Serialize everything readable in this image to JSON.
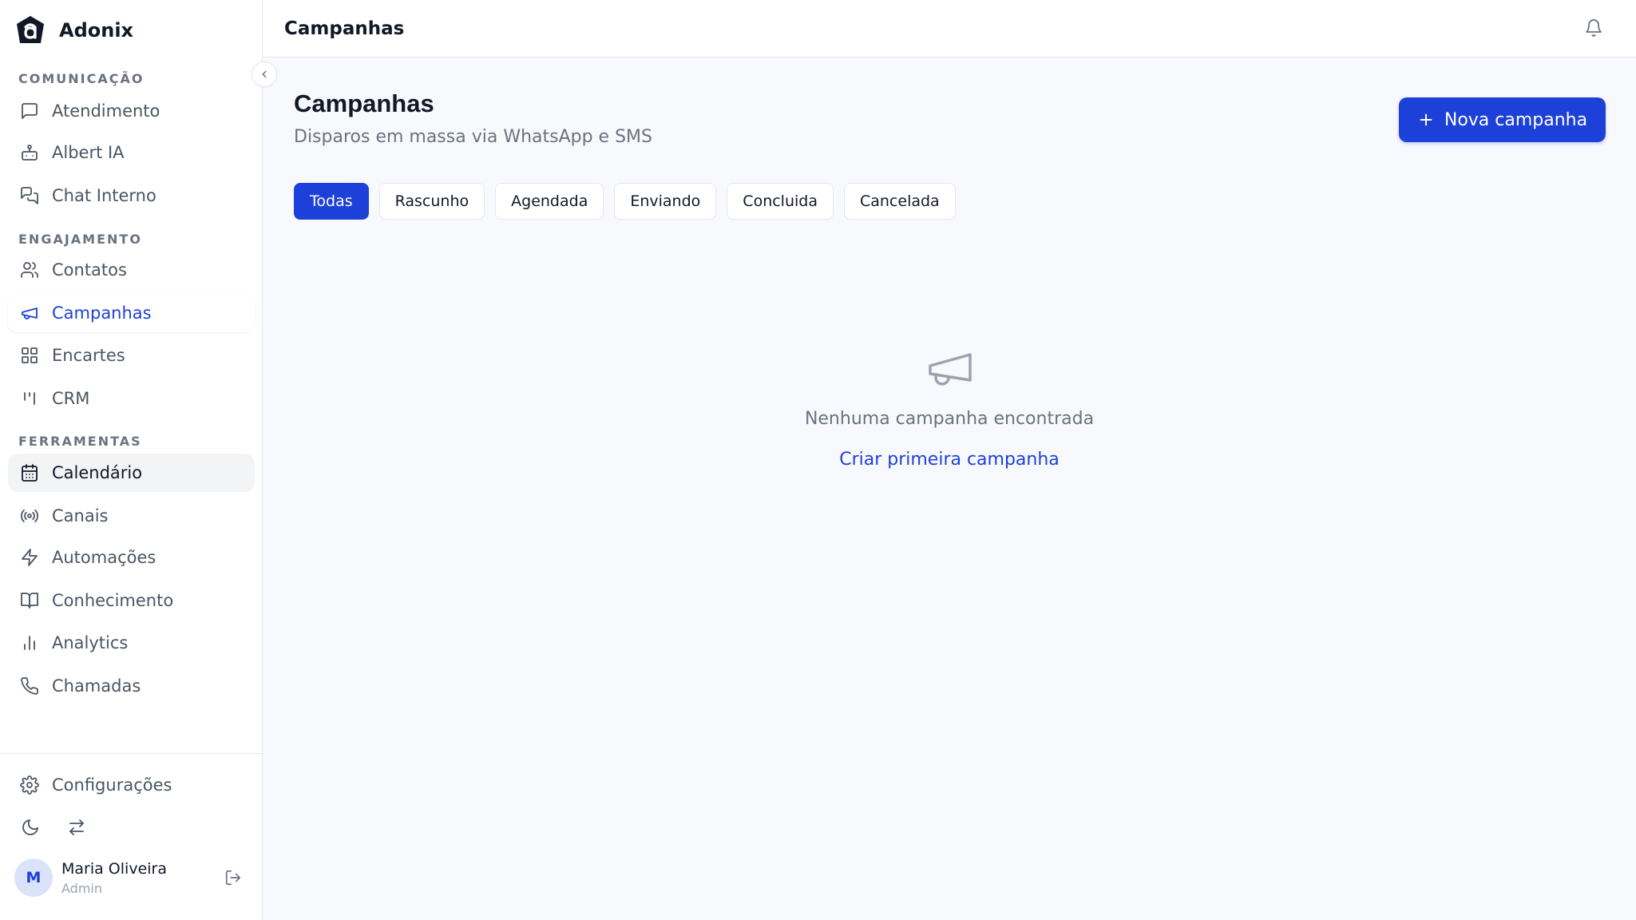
{
  "brand": {
    "name": "Adonix"
  },
  "sidebar": {
    "sections": [
      {
        "label": "COMUNICAÇÃO"
      },
      {
        "label": "ENGAJAMENTO"
      },
      {
        "label": "FERRAMENTAS"
      }
    ],
    "items": [
      {
        "label": "Atendimento",
        "icon": "message-square-icon"
      },
      {
        "label": "Albert IA",
        "icon": "bot-icon"
      },
      {
        "label": "Chat Interno",
        "icon": "messages-icon"
      },
      {
        "label": "Contatos",
        "icon": "users-icon"
      },
      {
        "label": "Campanhas",
        "icon": "megaphone-icon",
        "state": "active"
      },
      {
        "label": "Encartes",
        "icon": "grid-icon"
      },
      {
        "label": "CRM",
        "icon": "kanban-icon"
      },
      {
        "label": "Calendário",
        "icon": "calendar-icon",
        "state": "hover"
      },
      {
        "label": "Canais",
        "icon": "radio-icon"
      },
      {
        "label": "Automações",
        "icon": "zap-icon"
      },
      {
        "label": "Conhecimento",
        "icon": "book-open-icon"
      },
      {
        "label": "Analytics",
        "icon": "bar-chart-icon"
      },
      {
        "label": "Chamadas",
        "icon": "phone-icon"
      }
    ],
    "settings_label": "Configurações",
    "user": {
      "initial": "M",
      "name": "Maria Oliveira",
      "role": "Admin"
    }
  },
  "topbar": {
    "title": "Campanhas"
  },
  "page": {
    "title": "Campanhas",
    "subtitle": "Disparos em massa via WhatsApp e SMS",
    "new_button_label": "Nova campanha",
    "filters": [
      "Todas",
      "Rascunho",
      "Agendada",
      "Enviando",
      "Concluida",
      "Cancelada"
    ],
    "active_filter": "Todas",
    "empty_text": "Nenhuma campanha encontrada",
    "empty_link": "Criar primeira campanha"
  },
  "colors": {
    "accent": "#1d40d8",
    "muted": "#6b7280"
  }
}
